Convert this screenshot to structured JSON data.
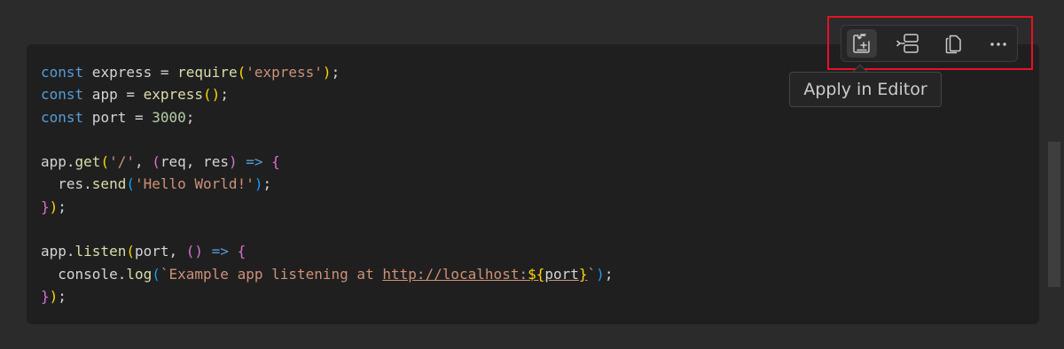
{
  "code": {
    "lines": [
      [
        {
          "t": "const",
          "c": "kw"
        },
        {
          "t": " express = ",
          "c": "op"
        },
        {
          "t": "require",
          "c": "fn"
        },
        {
          "t": "(",
          "c": "p1"
        },
        {
          "t": "'express'",
          "c": "str"
        },
        {
          "t": ")",
          "c": "p1"
        },
        {
          "t": ";",
          "c": "op"
        }
      ],
      [
        {
          "t": "const",
          "c": "kw"
        },
        {
          "t": " app = ",
          "c": "op"
        },
        {
          "t": "express",
          "c": "fn"
        },
        {
          "t": "()",
          "c": "p1"
        },
        {
          "t": ";",
          "c": "op"
        }
      ],
      [
        {
          "t": "const",
          "c": "kw"
        },
        {
          "t": " port = ",
          "c": "op"
        },
        {
          "t": "3000",
          "c": "num"
        },
        {
          "t": ";",
          "c": "op"
        }
      ],
      [],
      [
        {
          "t": "app.",
          "c": "op"
        },
        {
          "t": "get",
          "c": "fn"
        },
        {
          "t": "(",
          "c": "p1"
        },
        {
          "t": "'/'",
          "c": "str"
        },
        {
          "t": ", ",
          "c": "op"
        },
        {
          "t": "(",
          "c": "p2"
        },
        {
          "t": "req, res",
          "c": "op"
        },
        {
          "t": ")",
          "c": "p2"
        },
        {
          "t": " ",
          "c": "op"
        },
        {
          "t": "=>",
          "c": "kw"
        },
        {
          "t": " ",
          "c": "op"
        },
        {
          "t": "{",
          "c": "p2"
        }
      ],
      [
        {
          "t": "  res.",
          "c": "op"
        },
        {
          "t": "send",
          "c": "fn"
        },
        {
          "t": "(",
          "c": "p3"
        },
        {
          "t": "'Hello World!'",
          "c": "str"
        },
        {
          "t": ")",
          "c": "p3"
        },
        {
          "t": ";",
          "c": "op"
        }
      ],
      [
        {
          "t": "}",
          "c": "p2"
        },
        {
          "t": ")",
          "c": "p1"
        },
        {
          "t": ";",
          "c": "op"
        }
      ],
      [],
      [
        {
          "t": "app.",
          "c": "op"
        },
        {
          "t": "listen",
          "c": "fn"
        },
        {
          "t": "(",
          "c": "p1"
        },
        {
          "t": "port, ",
          "c": "op"
        },
        {
          "t": "()",
          "c": "p2"
        },
        {
          "t": " ",
          "c": "op"
        },
        {
          "t": "=>",
          "c": "kw"
        },
        {
          "t": " ",
          "c": "op"
        },
        {
          "t": "{",
          "c": "p2"
        }
      ],
      [
        {
          "t": "  console.",
          "c": "op"
        },
        {
          "t": "log",
          "c": "fn"
        },
        {
          "t": "(",
          "c": "p3"
        },
        {
          "t": "`Example app listening at ",
          "c": "str"
        },
        {
          "t": "http://localhost:",
          "c": "link"
        },
        {
          "t": "${",
          "c": "interp"
        },
        {
          "t": "port",
          "c": "interp-var"
        },
        {
          "t": "}",
          "c": "interp"
        },
        {
          "t": "`",
          "c": "str"
        },
        {
          "t": ")",
          "c": "p3"
        },
        {
          "t": ";",
          "c": "op"
        }
      ],
      [
        {
          "t": "}",
          "c": "p2"
        },
        {
          "t": ")",
          "c": "p1"
        },
        {
          "t": ";",
          "c": "op"
        }
      ]
    ]
  },
  "toolbar": {
    "buttons": [
      {
        "name": "apply-in-editor-button",
        "icon": "apply-in-editor-icon",
        "active": true
      },
      {
        "name": "insert-at-cursor-button",
        "icon": "insert-at-cursor-icon",
        "active": false
      },
      {
        "name": "copy-button",
        "icon": "copy-icon",
        "active": false
      },
      {
        "name": "more-actions-button",
        "icon": "ellipsis-icon",
        "active": false
      }
    ]
  },
  "tooltip": {
    "text": "Apply in Editor"
  },
  "colors": {
    "highlight_border": "#e81123",
    "keyword": "#569cd6",
    "function": "#dcdcaa",
    "string": "#ce9178",
    "number": "#b5cea8"
  }
}
